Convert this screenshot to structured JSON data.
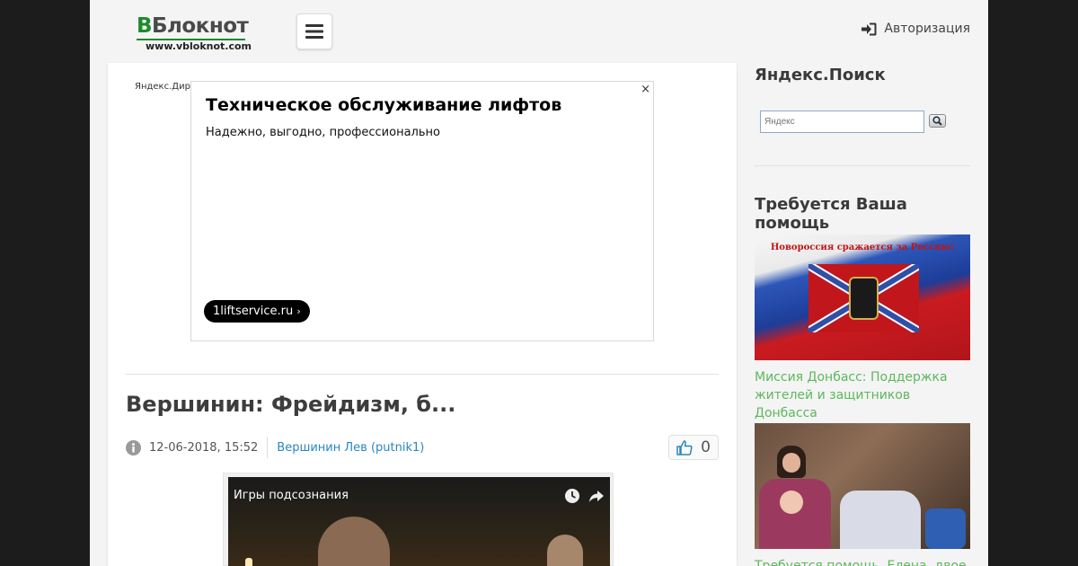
{
  "header": {
    "logo_main_accent": "В",
    "logo_main_rest": "Блокнот",
    "logo_sub": "www.vbloknot.com",
    "auth_label": "Авторизация"
  },
  "ad": {
    "label": "Яндекс.Директ",
    "title": "Техническое обслуживание лифтов",
    "text": "Надежно, выгодно, профессионально",
    "link": "1liftservice.ru",
    "close": "×"
  },
  "article": {
    "title": "Вершинин: Фрейдизм, б...",
    "date": "12-06-2018, 15:52",
    "author": "Вершинин Лев (putnik1)",
    "likes": "0",
    "video_title": "Игры подсознания"
  },
  "sidebar": {
    "search_heading": "Яндекс.Поиск",
    "search_placeholder": "Яндекс",
    "help_heading": "Требуется Ваша помощь",
    "items": [
      {
        "image_caption": "Новороссия сражается за Россию!",
        "link": "Миссия Донбасс: Поддержка жителей и защитников Донбасса"
      },
      {
        "link": "Требуется помощь. Елена, двое с"
      }
    ]
  },
  "colors": {
    "logo_green": "#1d8a2d",
    "link_blue": "#2a86bf",
    "sidebar_link_green": "#5cb85c"
  },
  "icons": [
    "menu-icon",
    "sign-in-icon",
    "info-icon",
    "thumbs-up-icon",
    "search-icon",
    "clock-icon",
    "share-icon"
  ]
}
